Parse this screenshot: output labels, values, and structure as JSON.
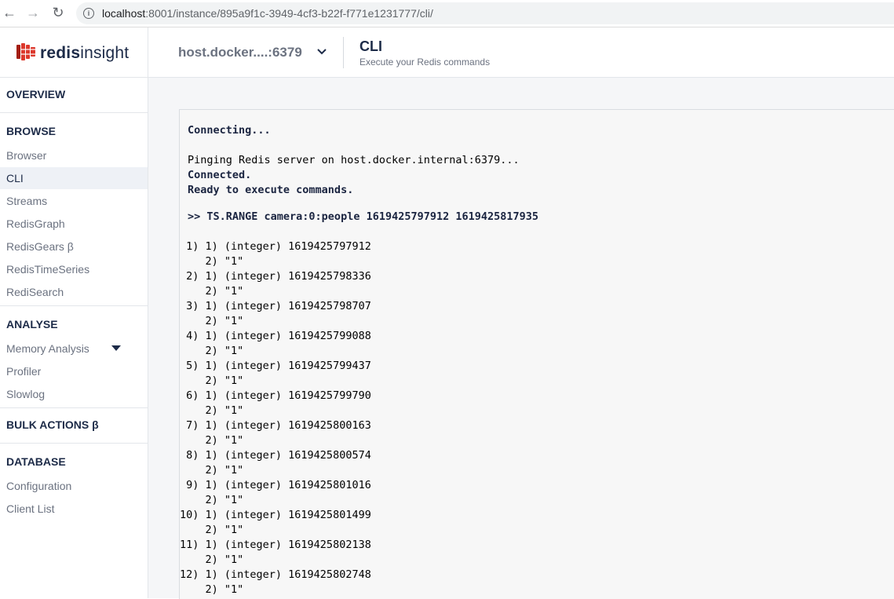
{
  "browser": {
    "url_host": "localhost",
    "url_rest": ":8001/instance/895a9f1c-3949-4cf3-b22f-f771e1231777/cli/",
    "back_icon": "←",
    "forward_icon": "→",
    "reload_icon": "↻",
    "info_icon": "i"
  },
  "header": {
    "logo_bold": "redis",
    "logo_light": "insight",
    "db_selector": "host.docker....:6379",
    "title": "CLI",
    "subtitle": "Execute your Redis commands"
  },
  "sidebar": {
    "overview": "OVERVIEW",
    "browse": "BROWSE",
    "browse_items": [
      "Browser",
      "CLI",
      "Streams",
      "RedisGraph",
      "RedisGears  β",
      "RedisTimeSeries",
      "RediSearch"
    ],
    "analyse": "ANALYSE",
    "analyse_items": [
      "Memory Analysis",
      "Profiler",
      "Slowlog"
    ],
    "bulk_actions": "BULK ACTIONS  β",
    "database": "DATABASE",
    "database_items": [
      "Configuration",
      "Client List"
    ]
  },
  "cli": {
    "connecting": "Connecting...",
    "pinging": "Pinging Redis server on host.docker.internal:6379...",
    "connected": "Connected.",
    "ready": "Ready to execute commands.",
    "command": ">> TS.RANGE camera:0:people 1619425797912 1619425817935",
    "results": [
      {
        "l1": " 1) 1) (integer) 1619425797912",
        "l2": "    2) \"1\""
      },
      {
        "l1": " 2) 1) (integer) 1619425798336",
        "l2": "    2) \"1\""
      },
      {
        "l1": " 3) 1) (integer) 1619425798707",
        "l2": "    2) \"1\""
      },
      {
        "l1": " 4) 1) (integer) 1619425799088",
        "l2": "    2) \"1\""
      },
      {
        "l1": " 5) 1) (integer) 1619425799437",
        "l2": "    2) \"1\""
      },
      {
        "l1": " 6) 1) (integer) 1619425799790",
        "l2": "    2) \"1\""
      },
      {
        "l1": " 7) 1) (integer) 1619425800163",
        "l2": "    2) \"1\""
      },
      {
        "l1": " 8) 1) (integer) 1619425800574",
        "l2": "    2) \"1\""
      },
      {
        "l1": " 9) 1) (integer) 1619425801016",
        "l2": "    2) \"1\""
      },
      {
        "l1": "10) 1) (integer) 1619425801499",
        "l2": "    2) \"1\""
      },
      {
        "l1": "11) 1) (integer) 1619425802138",
        "l2": "    2) \"1\""
      },
      {
        "l1": "12) 1) (integer) 1619425802748",
        "l2": "    2) \"1\""
      }
    ]
  },
  "colors": {
    "brand_red": "#dc382c",
    "navy": "#1d2b48",
    "muted": "#6b7280",
    "active_bg": "#eef1f6"
  }
}
